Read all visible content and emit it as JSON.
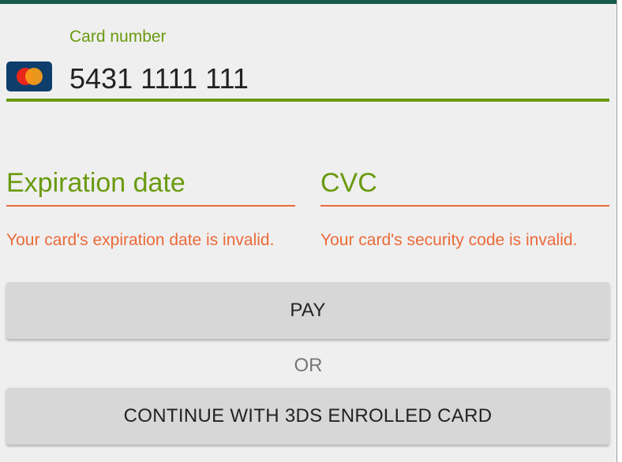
{
  "card_number": {
    "label": "Card number",
    "value": "5431 1111 111",
    "brand_icon": "mastercard-icon"
  },
  "expiration": {
    "hint": "Expiration date",
    "error": "Your card's expiration date is invalid."
  },
  "cvc": {
    "hint": "CVC",
    "error": "Your card's security code is invalid."
  },
  "actions": {
    "pay_label": "PAY",
    "or_label": "OR",
    "threeds_label": "CONTINUE WITH 3DS ENROLLED CARD"
  },
  "colors": {
    "accent": "#6a9a0e",
    "error": "#ec6a3a",
    "top_bar": "#155a47",
    "background": "#efefef",
    "button": "#d7d7d7"
  }
}
